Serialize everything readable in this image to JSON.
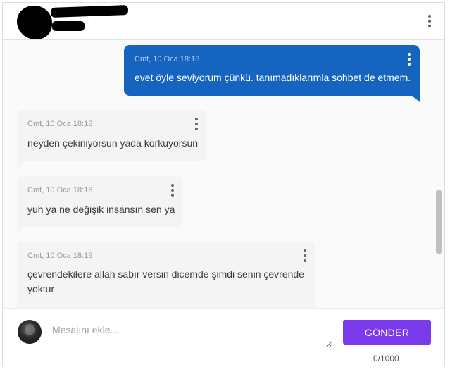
{
  "header": {
    "contact_name": "",
    "contact_status": ""
  },
  "messages": [
    {
      "direction": "outgoing",
      "time": "Cmt, 10 Oca 18:18",
      "text": "evet öyle seviyorum çünkü. tanımadıklarımla sohbet de etmem."
    },
    {
      "direction": "incoming",
      "time": "Cmt, 10 Oca 18:18",
      "text": "neyden çekiniyorsun yada korkuyorsun"
    },
    {
      "direction": "incoming",
      "time": "Cmt, 10 Oca 18:18",
      "text": "yuh ya ne değişik insansın sen ya"
    },
    {
      "direction": "incoming",
      "time": "Cmt, 10 Oca 18:19",
      "text": "çevrendekilere allah sabır versin dicemde şimdi senin çevrende yoktur"
    }
  ],
  "composer": {
    "placeholder": "Mesajını ekle...",
    "value": "",
    "send_label": "GÖNDER",
    "counter": "0/1000"
  },
  "colors": {
    "outgoing_bubble": "#1565c0",
    "incoming_bubble": "#f4f4f4",
    "send_button": "#7c3aed"
  },
  "icons": {
    "header_menu": "more-vertical-icon",
    "message_menu": "more-vertical-icon"
  }
}
